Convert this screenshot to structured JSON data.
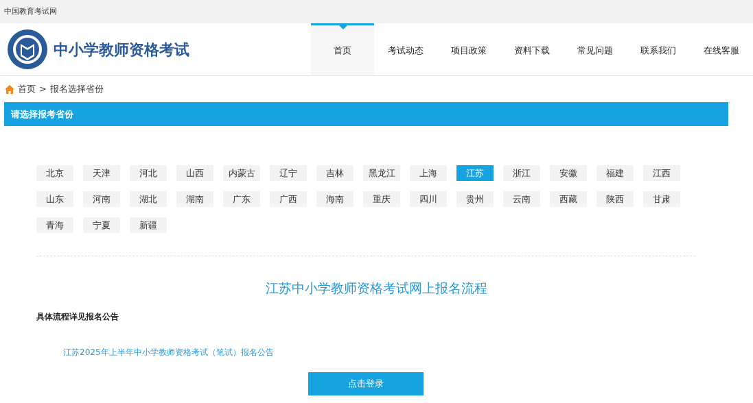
{
  "top_bar": {
    "site_name": "中国教育考试网"
  },
  "header": {
    "title": "中小学教师资格考试"
  },
  "nav": [
    {
      "label": "首页",
      "selected": true
    },
    {
      "label": "考试动态",
      "selected": false
    },
    {
      "label": "项目政策",
      "selected": false
    },
    {
      "label": "资料下载",
      "selected": false
    },
    {
      "label": "常见问题",
      "selected": false
    },
    {
      "label": "联系我们",
      "selected": false
    },
    {
      "label": "在线客服",
      "selected": false
    }
  ],
  "breadcrumb": {
    "home": "首页",
    "separator": ">",
    "current": "报名选择省份"
  },
  "section_title": "请选择报考省份",
  "provinces": [
    {
      "label": "北京",
      "selected": false
    },
    {
      "label": "天津",
      "selected": false
    },
    {
      "label": "河北",
      "selected": false
    },
    {
      "label": "山西",
      "selected": false
    },
    {
      "label": "内蒙古",
      "selected": false
    },
    {
      "label": "辽宁",
      "selected": false
    },
    {
      "label": "吉林",
      "selected": false
    },
    {
      "label": "黑龙江",
      "selected": false
    },
    {
      "label": "上海",
      "selected": false
    },
    {
      "label": "江苏",
      "selected": true
    },
    {
      "label": "浙江",
      "selected": false
    },
    {
      "label": "安徽",
      "selected": false
    },
    {
      "label": "福建",
      "selected": false
    },
    {
      "label": "江西",
      "selected": false
    },
    {
      "label": "山东",
      "selected": false
    },
    {
      "label": "河南",
      "selected": false
    },
    {
      "label": "湖北",
      "selected": false
    },
    {
      "label": "湖南",
      "selected": false
    },
    {
      "label": "广东",
      "selected": false
    },
    {
      "label": "广西",
      "selected": false
    },
    {
      "label": "海南",
      "selected": false
    },
    {
      "label": "重庆",
      "selected": false
    },
    {
      "label": "四川",
      "selected": false
    },
    {
      "label": "贵州",
      "selected": false
    },
    {
      "label": "云南",
      "selected": false
    },
    {
      "label": "西藏",
      "selected": false
    },
    {
      "label": "陕西",
      "selected": false
    },
    {
      "label": "甘肃",
      "selected": false
    },
    {
      "label": "青海",
      "selected": false
    },
    {
      "label": "宁夏",
      "selected": false
    },
    {
      "label": "新疆",
      "selected": false
    }
  ],
  "process": {
    "title": "江苏中小学教师资格考试网上报名流程",
    "note": "具体流程详见报名公告",
    "link": "江苏2025年上半年中小学教师资格考试（笔试）报名公告",
    "button": "点击登录"
  }
}
